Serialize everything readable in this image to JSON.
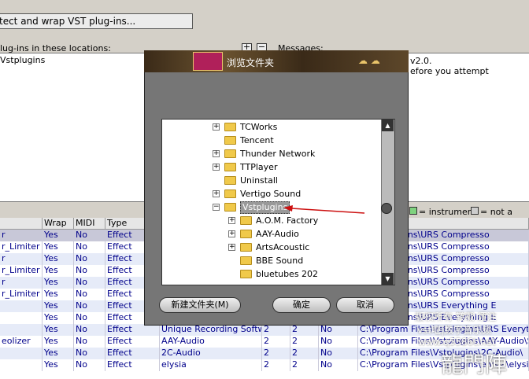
{
  "main": {
    "scan_button": "tect and wrap VST plug-ins...",
    "locations_label": "lug-ins in these locations:",
    "location_item": "Vstplugins",
    "plus": "+",
    "minus": "−",
    "messages_label": "Messages:",
    "messages": [
      "v2.0.",
      "efore you attempt"
    ],
    "legend_instrument": "= instrument",
    "legend_invalid": "= not a valid p"
  },
  "table": {
    "headers": [
      "",
      "Wrap",
      "MIDI",
      "Type",
      "",
      "",
      "",
      "",
      ""
    ],
    "rows": [
      [
        "r",
        "Yes",
        "No",
        "Effect",
        "",
        "",
        "",
        "",
        "es\\Vstplugins\\URS Compresso"
      ],
      [
        "r_Limiter",
        "Yes",
        "No",
        "Effect",
        "",
        "",
        "",
        "",
        "es\\Vstplugins\\URS Compresso"
      ],
      [
        "r",
        "Yes",
        "No",
        "Effect",
        "",
        "",
        "",
        "",
        "es\\Vstplugins\\URS Compresso"
      ],
      [
        "r_Limiter",
        "Yes",
        "No",
        "Effect",
        "",
        "",
        "",
        "",
        "es\\Vstplugins\\URS Compresso"
      ],
      [
        "r",
        "Yes",
        "No",
        "Effect",
        "",
        "",
        "",
        "",
        "es\\Vstplugins\\URS Compresso"
      ],
      [
        "r_Limiter",
        "Yes",
        "No",
        "Effect",
        "",
        "",
        "",
        "",
        "es\\Vstplugins\\URS Compresso"
      ],
      [
        "",
        "Yes",
        "No",
        "Effect",
        "",
        "",
        "",
        "",
        "es\\Vstplugins\\URS Everything E"
      ],
      [
        "",
        "Yes",
        "No",
        "Effect",
        "",
        "",
        "",
        "",
        "es\\Vstplugins\\URS Everything E"
      ],
      [
        "",
        "Yes",
        "No",
        "Effect",
        "Unique Recording Softw",
        "2",
        "2",
        "No",
        "C:\\Program Files\\Vstplugins\\URS Everything E"
      ],
      [
        "eolizer",
        "Yes",
        "No",
        "Effect",
        "AAY-Audio",
        "2",
        "2",
        "No",
        "C:\\Program Files\\Vstplugins\\AAY-Audio\\Ste"
      ],
      [
        "",
        "Yes",
        "No",
        "Effect",
        "2C-Audio",
        "2",
        "2",
        "No",
        "C:\\Program Files\\Vstplugins\\2C-Audio\\"
      ],
      [
        "",
        "Yes",
        "No",
        "Effect",
        "elysia",
        "2",
        "2",
        "No",
        "C:\\Program Files\\Vstplugins\\elysia\\elysia al"
      ]
    ]
  },
  "dialog": {
    "title": "浏览文件夹",
    "tree": [
      {
        "label": "TCWorks",
        "indent": 0,
        "expander": "+"
      },
      {
        "label": "Tencent",
        "indent": 0,
        "expander": ""
      },
      {
        "label": "Thunder Network",
        "indent": 0,
        "expander": "+"
      },
      {
        "label": "TTPlayer",
        "indent": 0,
        "expander": "+"
      },
      {
        "label": "Uninstall",
        "indent": 0,
        "expander": ""
      },
      {
        "label": "Vertigo Sound",
        "indent": 0,
        "expander": "+"
      },
      {
        "label": "Vstplugins",
        "indent": 0,
        "expander": "−",
        "selected": true
      },
      {
        "label": "A.O.M. Factory",
        "indent": 1,
        "expander": "+"
      },
      {
        "label": "AAY-Audio",
        "indent": 1,
        "expander": "+"
      },
      {
        "label": "ArtsAcoustic",
        "indent": 1,
        "expander": "+"
      },
      {
        "label": "BBE Sound",
        "indent": 1,
        "expander": ""
      },
      {
        "label": "bluetubes 202",
        "indent": 1,
        "expander": ""
      }
    ],
    "new_folder_button": "新建文件夹(M)",
    "ok_button": "确定",
    "cancel_button": "取消"
  },
  "watermark": {
    "line1": "版权所有 转载 须注",
    "line2": "vst吧|数字音乐频",
    "line3": "www.q5586t.net",
    "brand": "龍門陣"
  },
  "colors": {
    "accent": "#00008b",
    "instrument": "#7fd27f",
    "selection": "#999999"
  }
}
